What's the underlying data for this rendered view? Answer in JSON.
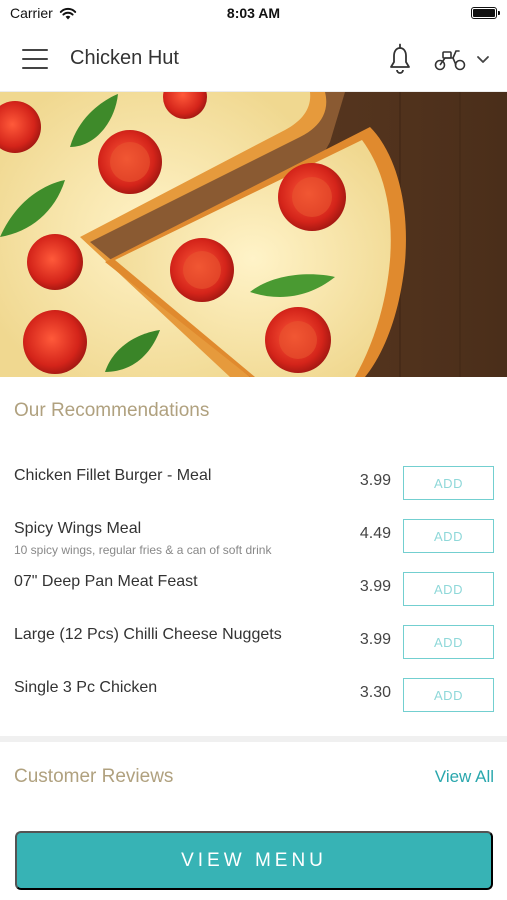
{
  "status_bar": {
    "carrier": "Carrier",
    "time": "8:03 AM",
    "battery_level": 1.0
  },
  "header": {
    "title": "Chicken Hut",
    "icons": [
      "menu-icon",
      "bell-icon",
      "scooter-icon",
      "chevron-down-icon"
    ]
  },
  "hero": {
    "image": "pizza-photo"
  },
  "recommendations": {
    "title": "Our Recommendations",
    "items": [
      {
        "name": "Chicken Fillet Burger - Meal",
        "description": "",
        "price": "3.99",
        "action": "ADD"
      },
      {
        "name": "Spicy Wings Meal",
        "description": "10 spicy wings, regular fries & a can of soft drink",
        "price": "4.49",
        "action": "ADD"
      },
      {
        "name": "07\" Deep Pan Meat Feast",
        "description": "",
        "price": "3.99",
        "action": "ADD"
      },
      {
        "name": "Large (12 Pcs) Chilli Cheese Nuggets",
        "description": "",
        "price": "3.99",
        "action": "ADD"
      },
      {
        "name": "Single 3 Pc Chicken",
        "description": "",
        "price": "3.30",
        "action": "ADD"
      }
    ]
  },
  "reviews": {
    "title": "Customer Reviews",
    "view_all": "View All"
  },
  "footer": {
    "button_label": "VIEW MENU"
  },
  "colors": {
    "accent": "#37b3b5",
    "section_title": "#b0a17f",
    "add_border": "#73cfd0"
  }
}
